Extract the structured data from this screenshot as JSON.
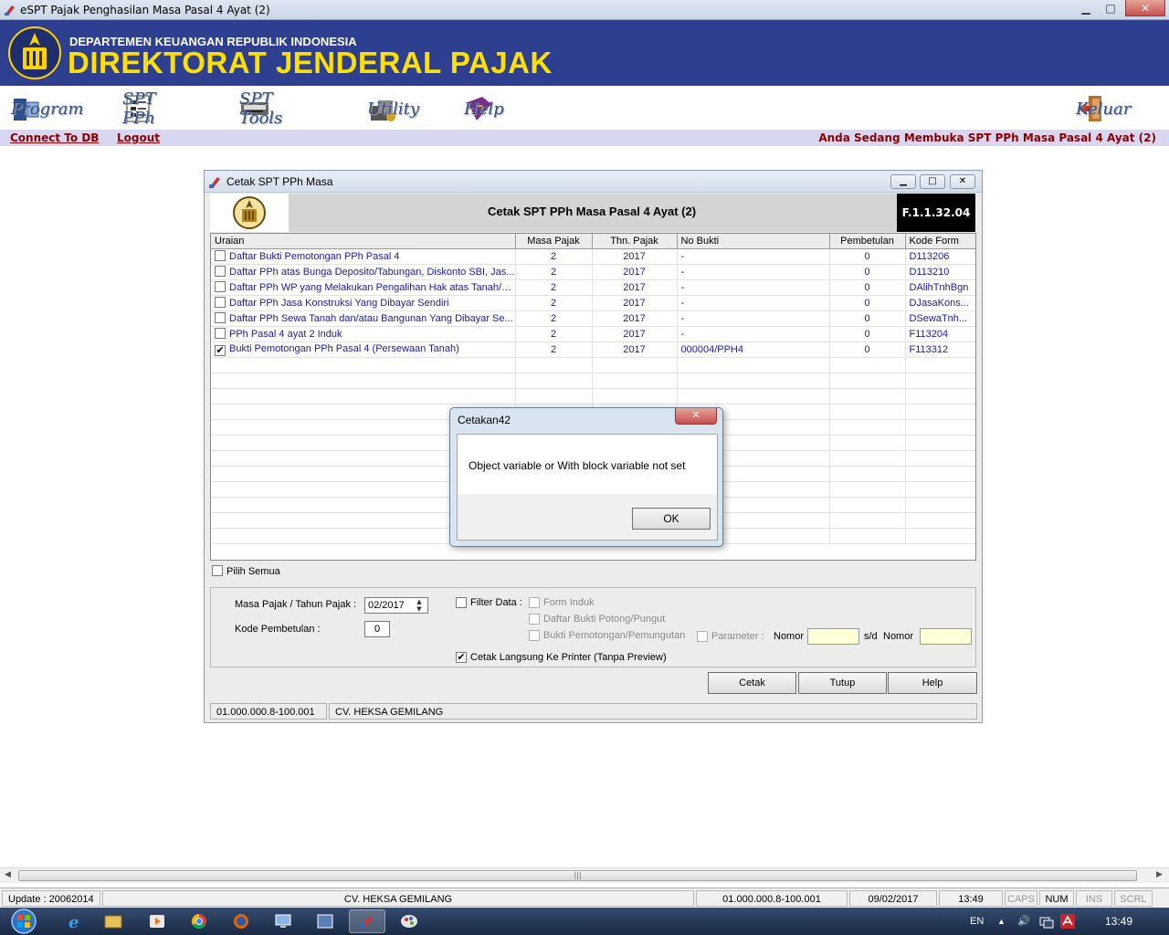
{
  "window": {
    "title": "eSPT Pajak Penghasilan Masa Pasal 4 Ayat (2)",
    "minimize": "▁",
    "maximize": "□",
    "close": "✕"
  },
  "banner": {
    "dept": "DEPARTEMEN KEUANGAN REPUBLIK INDONESIA",
    "dirjen": "DIREKTORAT JENDERAL PAJAK"
  },
  "toolbar": {
    "program": "Program",
    "spt_pph": "SPT PPh",
    "spt_tools": "SPT Tools",
    "utility": "Utility",
    "help": "Help",
    "keluar": "Keluar"
  },
  "linkbar": {
    "connect": "Connect To DB",
    "logout": "Logout",
    "info": "Anda Sedang Membuka SPT PPh Masa Pasal 4 Ayat (2)"
  },
  "dialog": {
    "title": "Cetak SPT PPh Masa",
    "header_title": "Cetak SPT PPh Masa Pasal 4 Ayat (2)",
    "form_code": "F.1.1.32.04",
    "columns": [
      "Uraian",
      "Masa Pajak",
      "Thn. Pajak",
      "No Bukti",
      "Pembetulan",
      "Kode Form"
    ],
    "rows": [
      {
        "checked": false,
        "uraian": "Daftar Bukti Pemotongan PPh Pasal 4",
        "masa": "2",
        "tahun": "2017",
        "bukti": "-",
        "pembetulan": "0",
        "kode": "D113206"
      },
      {
        "checked": false,
        "uraian": "Daftar PPh atas Bunga Deposito/Tabungan, Diskonto SBI, Jas...",
        "masa": "2",
        "tahun": "2017",
        "bukti": "-",
        "pembetulan": "0",
        "kode": "D113210"
      },
      {
        "checked": false,
        "uraian": "Daftar PPh WP yang Melakukan Pengalihan Hak atas Tanah/B...",
        "masa": "2",
        "tahun": "2017",
        "bukti": "-",
        "pembetulan": "0",
        "kode": "DAlihTnhBgn"
      },
      {
        "checked": false,
        "uraian": "Daftar PPh Jasa Konstruksi Yang Dibayar Sendiri",
        "masa": "2",
        "tahun": "2017",
        "bukti": "-",
        "pembetulan": "0",
        "kode": "DJasaKons..."
      },
      {
        "checked": false,
        "uraian": "Daftar PPh Sewa Tanah dan/atau Bangunan Yang Dibayar Se...",
        "masa": "2",
        "tahun": "2017",
        "bukti": "-",
        "pembetulan": "0",
        "kode": "DSewaTnh..."
      },
      {
        "checked": false,
        "uraian": "PPh Pasal 4 ayat 2 Induk",
        "masa": "2",
        "tahun": "2017",
        "bukti": "-",
        "pembetulan": "0",
        "kode": "F113204"
      },
      {
        "checked": true,
        "uraian": "Bukti Pemotongan PPh Pasal 4 (Persewaan Tanah)",
        "masa": "2",
        "tahun": "2017",
        "bukti": "000004/PPH4",
        "pembetulan": "0",
        "kode": "F113312"
      }
    ],
    "pilih_semua": "Pilih Semua",
    "masa_label": "Masa Pajak / Tahun Pajak :",
    "masa_value": "02/2017",
    "kode_label": "Kode Pembetulan :",
    "kode_value": "0",
    "filter_label": "Filter Data :",
    "form_induk": "Form Induk",
    "daftar_bukti": "Daftar Bukti Potong/Pungut",
    "bukti_pemotongan": "Bukti Pemotongan/Pemungutan",
    "parameter": "Parameter :",
    "nomor1": "Nomor",
    "sd": "s/d",
    "nomor2": "Nomor",
    "cetak_langsung": "Cetak Langsung Ke Printer (Tanpa Preview)",
    "btn_cetak": "Cetak",
    "btn_tutup": "Tutup",
    "btn_help": "Help",
    "npwp": "01.000.000.8-100.001",
    "company": "CV. HEKSA GEMILANG"
  },
  "message": {
    "title": "Cetakan42",
    "text": "Object variable or With block variable not set",
    "ok": "OK"
  },
  "statusbar": {
    "update": "Update : 20062014",
    "company": "CV. HEKSA GEMILANG",
    "npwp": "01.000.000.8-100.001",
    "date": "09/02/2017",
    "time": "13:49",
    "caps": "CAPS",
    "num": "NUM",
    "ins": "INS",
    "scrl": "SCRL"
  },
  "taskbar": {
    "lang": "EN",
    "clock": "13:49"
  }
}
